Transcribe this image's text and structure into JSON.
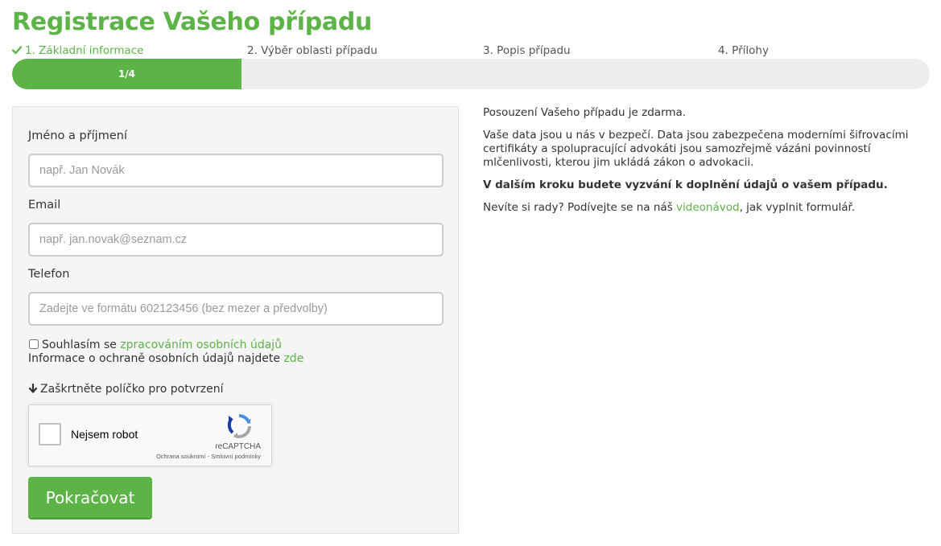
{
  "page_title": "Registrace Vašeho případu",
  "steps": [
    {
      "label": "1. Základní informace",
      "active": true
    },
    {
      "label": "2. Výběr oblasti případu",
      "active": false
    },
    {
      "label": "3. Popis případu",
      "active": false
    },
    {
      "label": "4. Přílohy",
      "active": false
    }
  ],
  "progress": {
    "label": "1/4",
    "fraction": 0.25
  },
  "form": {
    "name_label": "Jméno a příjmení",
    "name_placeholder": "např. Jan Novák",
    "email_label": "Email",
    "email_placeholder": "např. jan.novak@seznam.cz",
    "phone_label": "Telefon",
    "phone_placeholder": "Zadejte ve formátu 602123456 (bez mezer a předvolby)",
    "consent_prefix": "Souhlasím se ",
    "consent_link": "zpracováním osobních údajů",
    "privacy_prefix": "Informace o ochraně osobních údajů najdete ",
    "privacy_link": "zde",
    "hint": "Zaškrtněte políčko pro potvrzení",
    "submit_label": "Pokračovat"
  },
  "recaptcha": {
    "label": "Nejsem robot",
    "brand": "reCAPTCHA",
    "terms": "Ochrana soukromí - Smluvní podmínky"
  },
  "info": {
    "p1": "Posouzení Vašeho případu je zdarma.",
    "p2": "Vaše data jsou u nás v bezpečí. Data jsou zabezpečena moderními šifrovacími certifikáty a spolupracující advokáti jsou samozřejmě vázáni povinností mlčenlivosti, kterou jim ukládá zákon o advokacii.",
    "p3": "V dalším kroku budete vyzvání k doplnění údajů o vašem případu.",
    "p4_prefix": "Nevíte si rady? Podívejte se na náš ",
    "p4_link": "videonávod",
    "p4_suffix": ", jak vyplnit formulář."
  },
  "colors": {
    "brand_green": "#5cb346",
    "progress_track": "#ededee",
    "panel_bg": "#f5f5f5"
  },
  "icons": {
    "step_done": "check-icon",
    "hint": "arrow-down-icon",
    "recaptcha": "recaptcha-logo-icon"
  }
}
